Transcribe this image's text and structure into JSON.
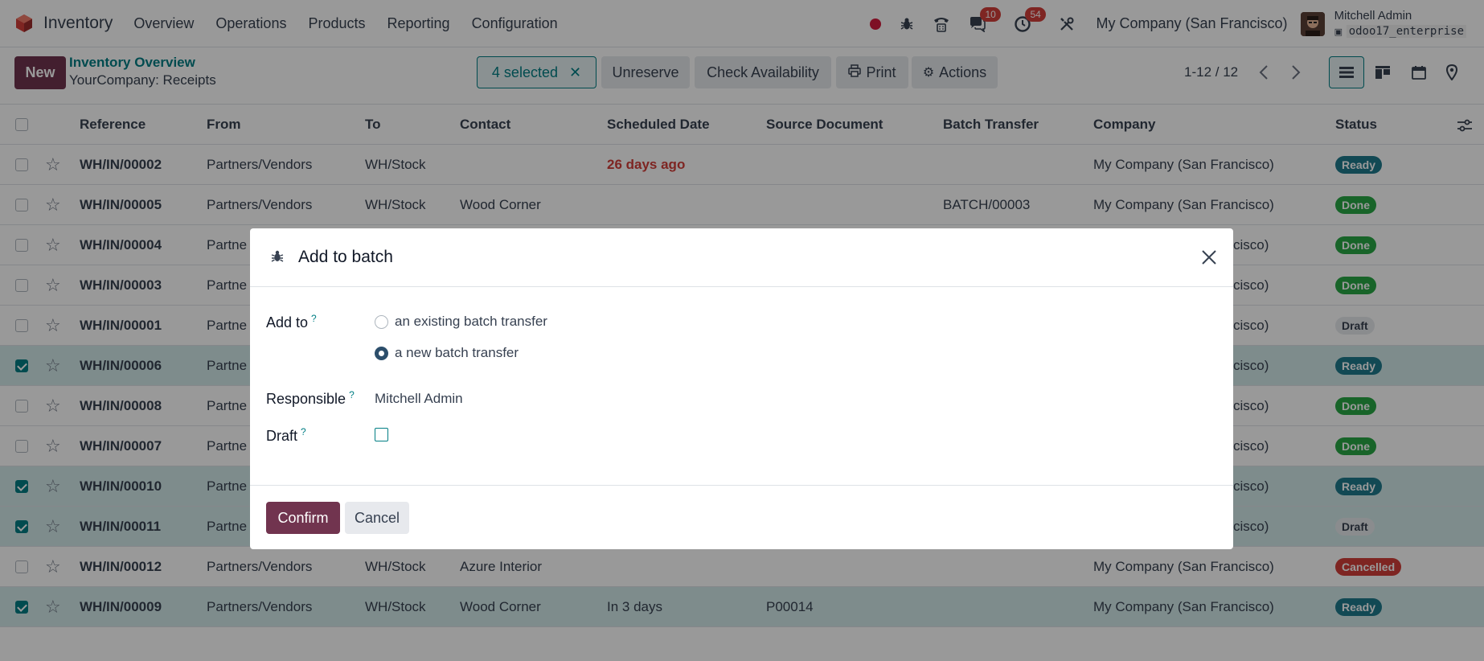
{
  "navbar": {
    "app_name": "Inventory",
    "menu": [
      "Overview",
      "Operations",
      "Products",
      "Reporting",
      "Configuration"
    ],
    "chat_badge": "10",
    "activity_badge": "54",
    "company": "My Company (San Francisco)",
    "user_name": "Mitchell Admin",
    "db_name": "odoo17_enterprise"
  },
  "control": {
    "new_label": "New",
    "breadcrumb_parent": "Inventory Overview",
    "breadcrumb_current": "YourCompany: Receipts",
    "selected_label": "4 selected",
    "unreserve_label": "Unreserve",
    "check_availability_label": "Check Availability",
    "print_label": "Print",
    "actions_label": "Actions",
    "pager": "1-12 / 12"
  },
  "table": {
    "headers": {
      "reference": "Reference",
      "from": "From",
      "to": "To",
      "contact": "Contact",
      "scheduled_date": "Scheduled Date",
      "source_document": "Source Document",
      "batch_transfer": "Batch Transfer",
      "company": "Company",
      "status": "Status"
    },
    "rows": [
      {
        "ref": "WH/IN/00002",
        "from": "Partners/Vendors",
        "to": "WH/Stock",
        "contact": "",
        "date": "26 days ago",
        "source": "",
        "batch": "",
        "company": "My Company (San Francisco)",
        "status": "Ready"
      },
      {
        "ref": "WH/IN/00005",
        "from": "Partners/Vendors",
        "to": "WH/Stock",
        "contact": "Wood Corner",
        "date": "",
        "source": "",
        "batch": "BATCH/00003",
        "company": "My Company (San Francisco)",
        "status": "Done"
      },
      {
        "ref": "WH/IN/00004",
        "from": "Partne",
        "to": "",
        "contact": "",
        "date": "",
        "source": "",
        "batch": "",
        "company": "cisco)",
        "status": "Done"
      },
      {
        "ref": "WH/IN/00003",
        "from": "Partne",
        "to": "",
        "contact": "",
        "date": "",
        "source": "",
        "batch": "",
        "company": "cisco)",
        "status": "Done"
      },
      {
        "ref": "WH/IN/00001",
        "from": "Partne",
        "to": "",
        "contact": "",
        "date": "",
        "source": "",
        "batch": "",
        "company": "cisco)",
        "status": "Draft"
      },
      {
        "ref": "WH/IN/00006",
        "from": "Partne",
        "to": "",
        "contact": "",
        "date": "",
        "source": "",
        "batch": "",
        "company": "cisco)",
        "status": "Ready"
      },
      {
        "ref": "WH/IN/00008",
        "from": "Partne",
        "to": "",
        "contact": "",
        "date": "",
        "source": "",
        "batch": "",
        "company": "cisco)",
        "status": "Done"
      },
      {
        "ref": "WH/IN/00007",
        "from": "Partne",
        "to": "",
        "contact": "",
        "date": "",
        "source": "",
        "batch": "",
        "company": "cisco)",
        "status": "Done"
      },
      {
        "ref": "WH/IN/00010",
        "from": "Partne",
        "to": "",
        "contact": "",
        "date": "",
        "source": "",
        "batch": "",
        "company": "cisco)",
        "status": "Ready"
      },
      {
        "ref": "WH/IN/00011",
        "from": "Partne",
        "to": "",
        "contact": "",
        "date": "",
        "source": "",
        "batch": "",
        "company": "cisco)",
        "status": "Draft"
      },
      {
        "ref": "WH/IN/00012",
        "from": "Partners/Vendors",
        "to": "WH/Stock",
        "contact": "Azure Interior",
        "date": "",
        "source": "",
        "batch": "",
        "company": "My Company (San Francisco)",
        "status": "Cancelled"
      },
      {
        "ref": "WH/IN/00009",
        "from": "Partners/Vendors",
        "to": "WH/Stock",
        "contact": "Wood Corner",
        "date": "In 3 days",
        "source": "P00014",
        "batch": "",
        "company": "My Company (San Francisco)",
        "status": "Ready"
      }
    ]
  },
  "modal": {
    "title": "Add to batch",
    "add_to_label": "Add to",
    "option_existing": "an existing batch transfer",
    "option_new": "a new batch transfer",
    "responsible_label": "Responsible",
    "responsible_value": "Mitchell Admin",
    "draft_label": "Draft",
    "help_mark": "?",
    "confirm_label": "Confirm",
    "cancel_label": "Cancel"
  },
  "colors": {
    "brand": "#71344f",
    "accent": "#017e84",
    "danger": "#d23f3a"
  }
}
